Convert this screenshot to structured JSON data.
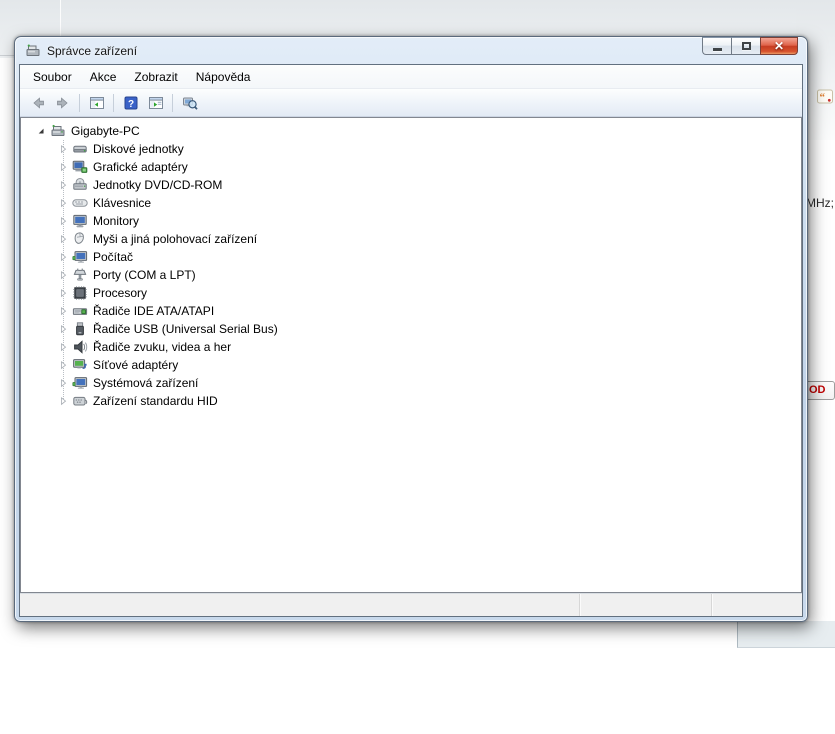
{
  "background": {
    "text_fragment": "MHz;",
    "button_fragment": "OD",
    "quote_icon": "quote-icon"
  },
  "window": {
    "title": "Správce zařízení",
    "app_icon": "device-manager-icon",
    "controls": [
      {
        "name": "minimize-button",
        "icon": "minimize-icon"
      },
      {
        "name": "maximize-button",
        "icon": "maximize-icon"
      },
      {
        "name": "close-button",
        "icon": "close-icon"
      }
    ],
    "menu": [
      {
        "label": "Soubor"
      },
      {
        "label": "Akce"
      },
      {
        "label": "Zobrazit"
      },
      {
        "label": "Nápověda"
      }
    ],
    "toolbar": [
      {
        "type": "button",
        "name": "back-button",
        "icon": "back-arrow-icon",
        "disabled": true
      },
      {
        "type": "button",
        "name": "forward-button",
        "icon": "forward-arrow-icon",
        "disabled": true
      },
      {
        "type": "separator"
      },
      {
        "type": "button",
        "name": "show-console-tree-button",
        "icon": "console-tree-icon"
      },
      {
        "type": "separator"
      },
      {
        "type": "button",
        "name": "help-button",
        "icon": "help-icon"
      },
      {
        "type": "button",
        "name": "show-action-pane-button",
        "icon": "console-action-icon"
      },
      {
        "type": "separator"
      },
      {
        "type": "button",
        "name": "scan-hardware-changes-button",
        "icon": "scan-hardware-icon"
      }
    ],
    "tree": {
      "root": {
        "label": "Gigabyte-PC",
        "icon": "computer-icon",
        "expanded": true
      },
      "children": [
        {
          "label": "Diskové jednotky",
          "icon": "disk-drive-icon"
        },
        {
          "label": "Grafické adaptéry",
          "icon": "display-adapter-icon"
        },
        {
          "label": "Jednotky DVD/CD-ROM",
          "icon": "dvd-drive-icon"
        },
        {
          "label": "Klávesnice",
          "icon": "keyboard-icon"
        },
        {
          "label": "Monitory",
          "icon": "monitor-icon"
        },
        {
          "label": "Myši a jiná polohovací zařízení",
          "icon": "mouse-icon"
        },
        {
          "label": "Počítač",
          "icon": "computer-device-icon"
        },
        {
          "label": "Porty (COM a LPT)",
          "icon": "ports-icon"
        },
        {
          "label": "Procesory",
          "icon": "processor-icon"
        },
        {
          "label": "Řadiče IDE ATA/ATAPI",
          "icon": "ide-controller-icon"
        },
        {
          "label": "Řadiče USB (Universal Serial Bus)",
          "icon": "usb-controller-icon"
        },
        {
          "label": "Řadiče zvuku, videa a her",
          "icon": "sound-controller-icon"
        },
        {
          "label": "Síťové adaptéry",
          "icon": "network-adapter-icon"
        },
        {
          "label": "Systémová zařízení",
          "icon": "system-device-icon"
        },
        {
          "label": "Zařízení standardu HID",
          "icon": "hid-device-icon"
        }
      ]
    },
    "status_bar": {
      "segments": [
        "",
        "",
        ""
      ]
    }
  },
  "colors": {
    "aero_frame": "#c8d9ec",
    "close_button_red": "#c63c22",
    "help_blue": "#3a62c8",
    "accent_green": "#43a047",
    "status_bar_bg": "#f0f0f0",
    "tree_bg": "#ffffff",
    "fragment_red": "#c00000"
  }
}
